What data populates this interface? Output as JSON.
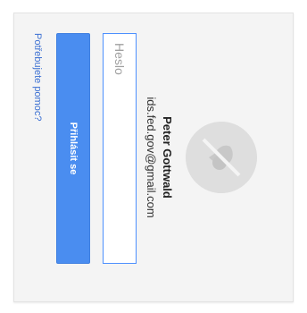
{
  "user": {
    "name": "Peter Gottwald",
    "email": "ids.fed.gov@gmail.com"
  },
  "password": {
    "placeholder": "Heslo",
    "value": ""
  },
  "signin": {
    "label": "Přihlásit se"
  },
  "help": {
    "label": "Potřebujete pomoc?"
  },
  "colors": {
    "accent": "#4a8df0",
    "link": "#3b6fd2",
    "focus_border": "#4d90fe"
  },
  "icons": {
    "avatar": "user-avatar-placeholder-icon"
  }
}
